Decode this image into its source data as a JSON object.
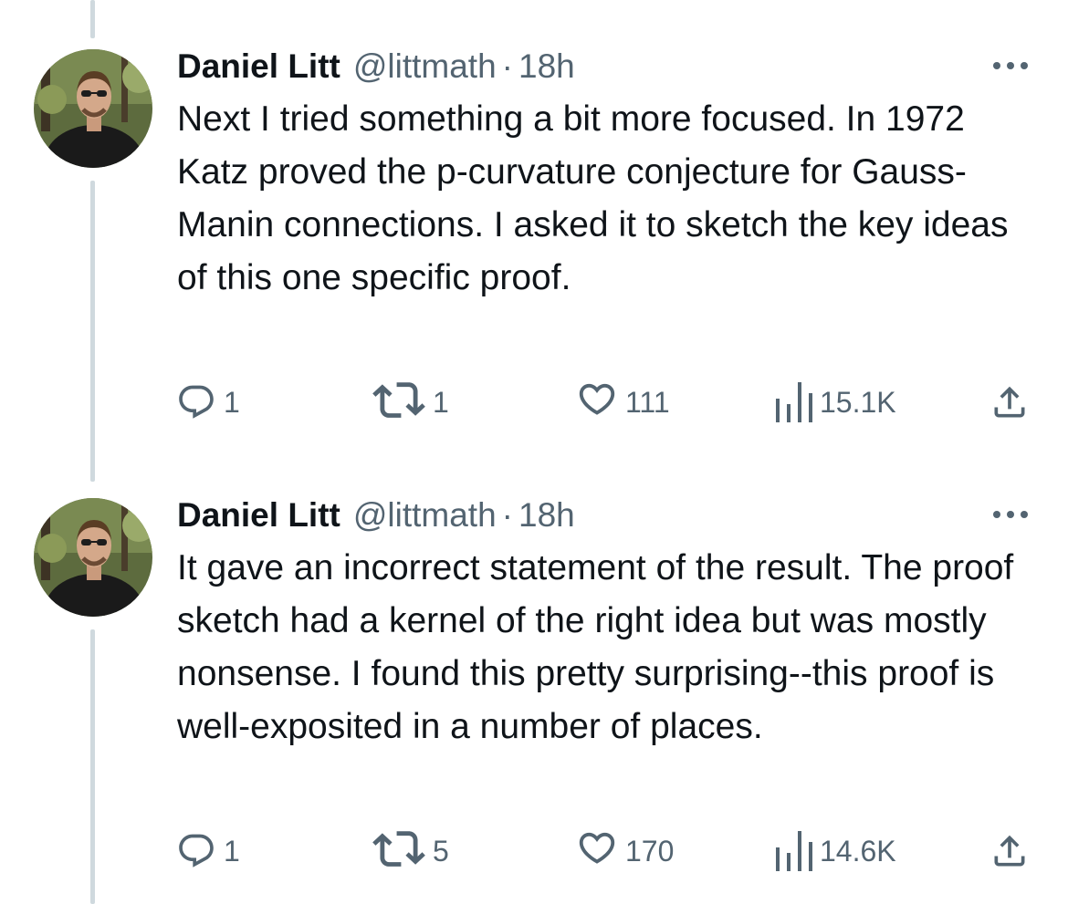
{
  "tweets": [
    {
      "author": {
        "name": "Daniel Litt",
        "handle": "@littmath",
        "separator": "·",
        "time": "18h"
      },
      "text": "Next I tried something a bit more focused. In 1972 Katz proved the p-curvature conjecture for Gauss-Manin connections. I asked it to sketch the key ideas of this one specific proof.",
      "stats": {
        "replies": "1",
        "reposts": "1",
        "likes": "111",
        "views": "15.1K"
      },
      "icons": [
        "more-icon",
        "reply-icon",
        "repost-icon",
        "like-icon",
        "views-icon",
        "share-icon"
      ]
    },
    {
      "author": {
        "name": "Daniel Litt",
        "handle": "@littmath",
        "separator": "·",
        "time": "18h"
      },
      "text": "It gave an incorrect statement of the result. The proof sketch had a kernel of the right idea but was mostly nonsense. I found this pretty surprising--this proof is well-exposited in a number of places.",
      "stats": {
        "replies": "1",
        "reposts": "5",
        "likes": "170",
        "views": "14.6K"
      },
      "icons": [
        "more-icon",
        "reply-icon",
        "repost-icon",
        "like-icon",
        "views-icon",
        "share-icon"
      ]
    }
  ],
  "colors": {
    "text": "#0f1419",
    "secondary": "#536471",
    "thread_line": "#cfd9de",
    "background": "#ffffff"
  }
}
